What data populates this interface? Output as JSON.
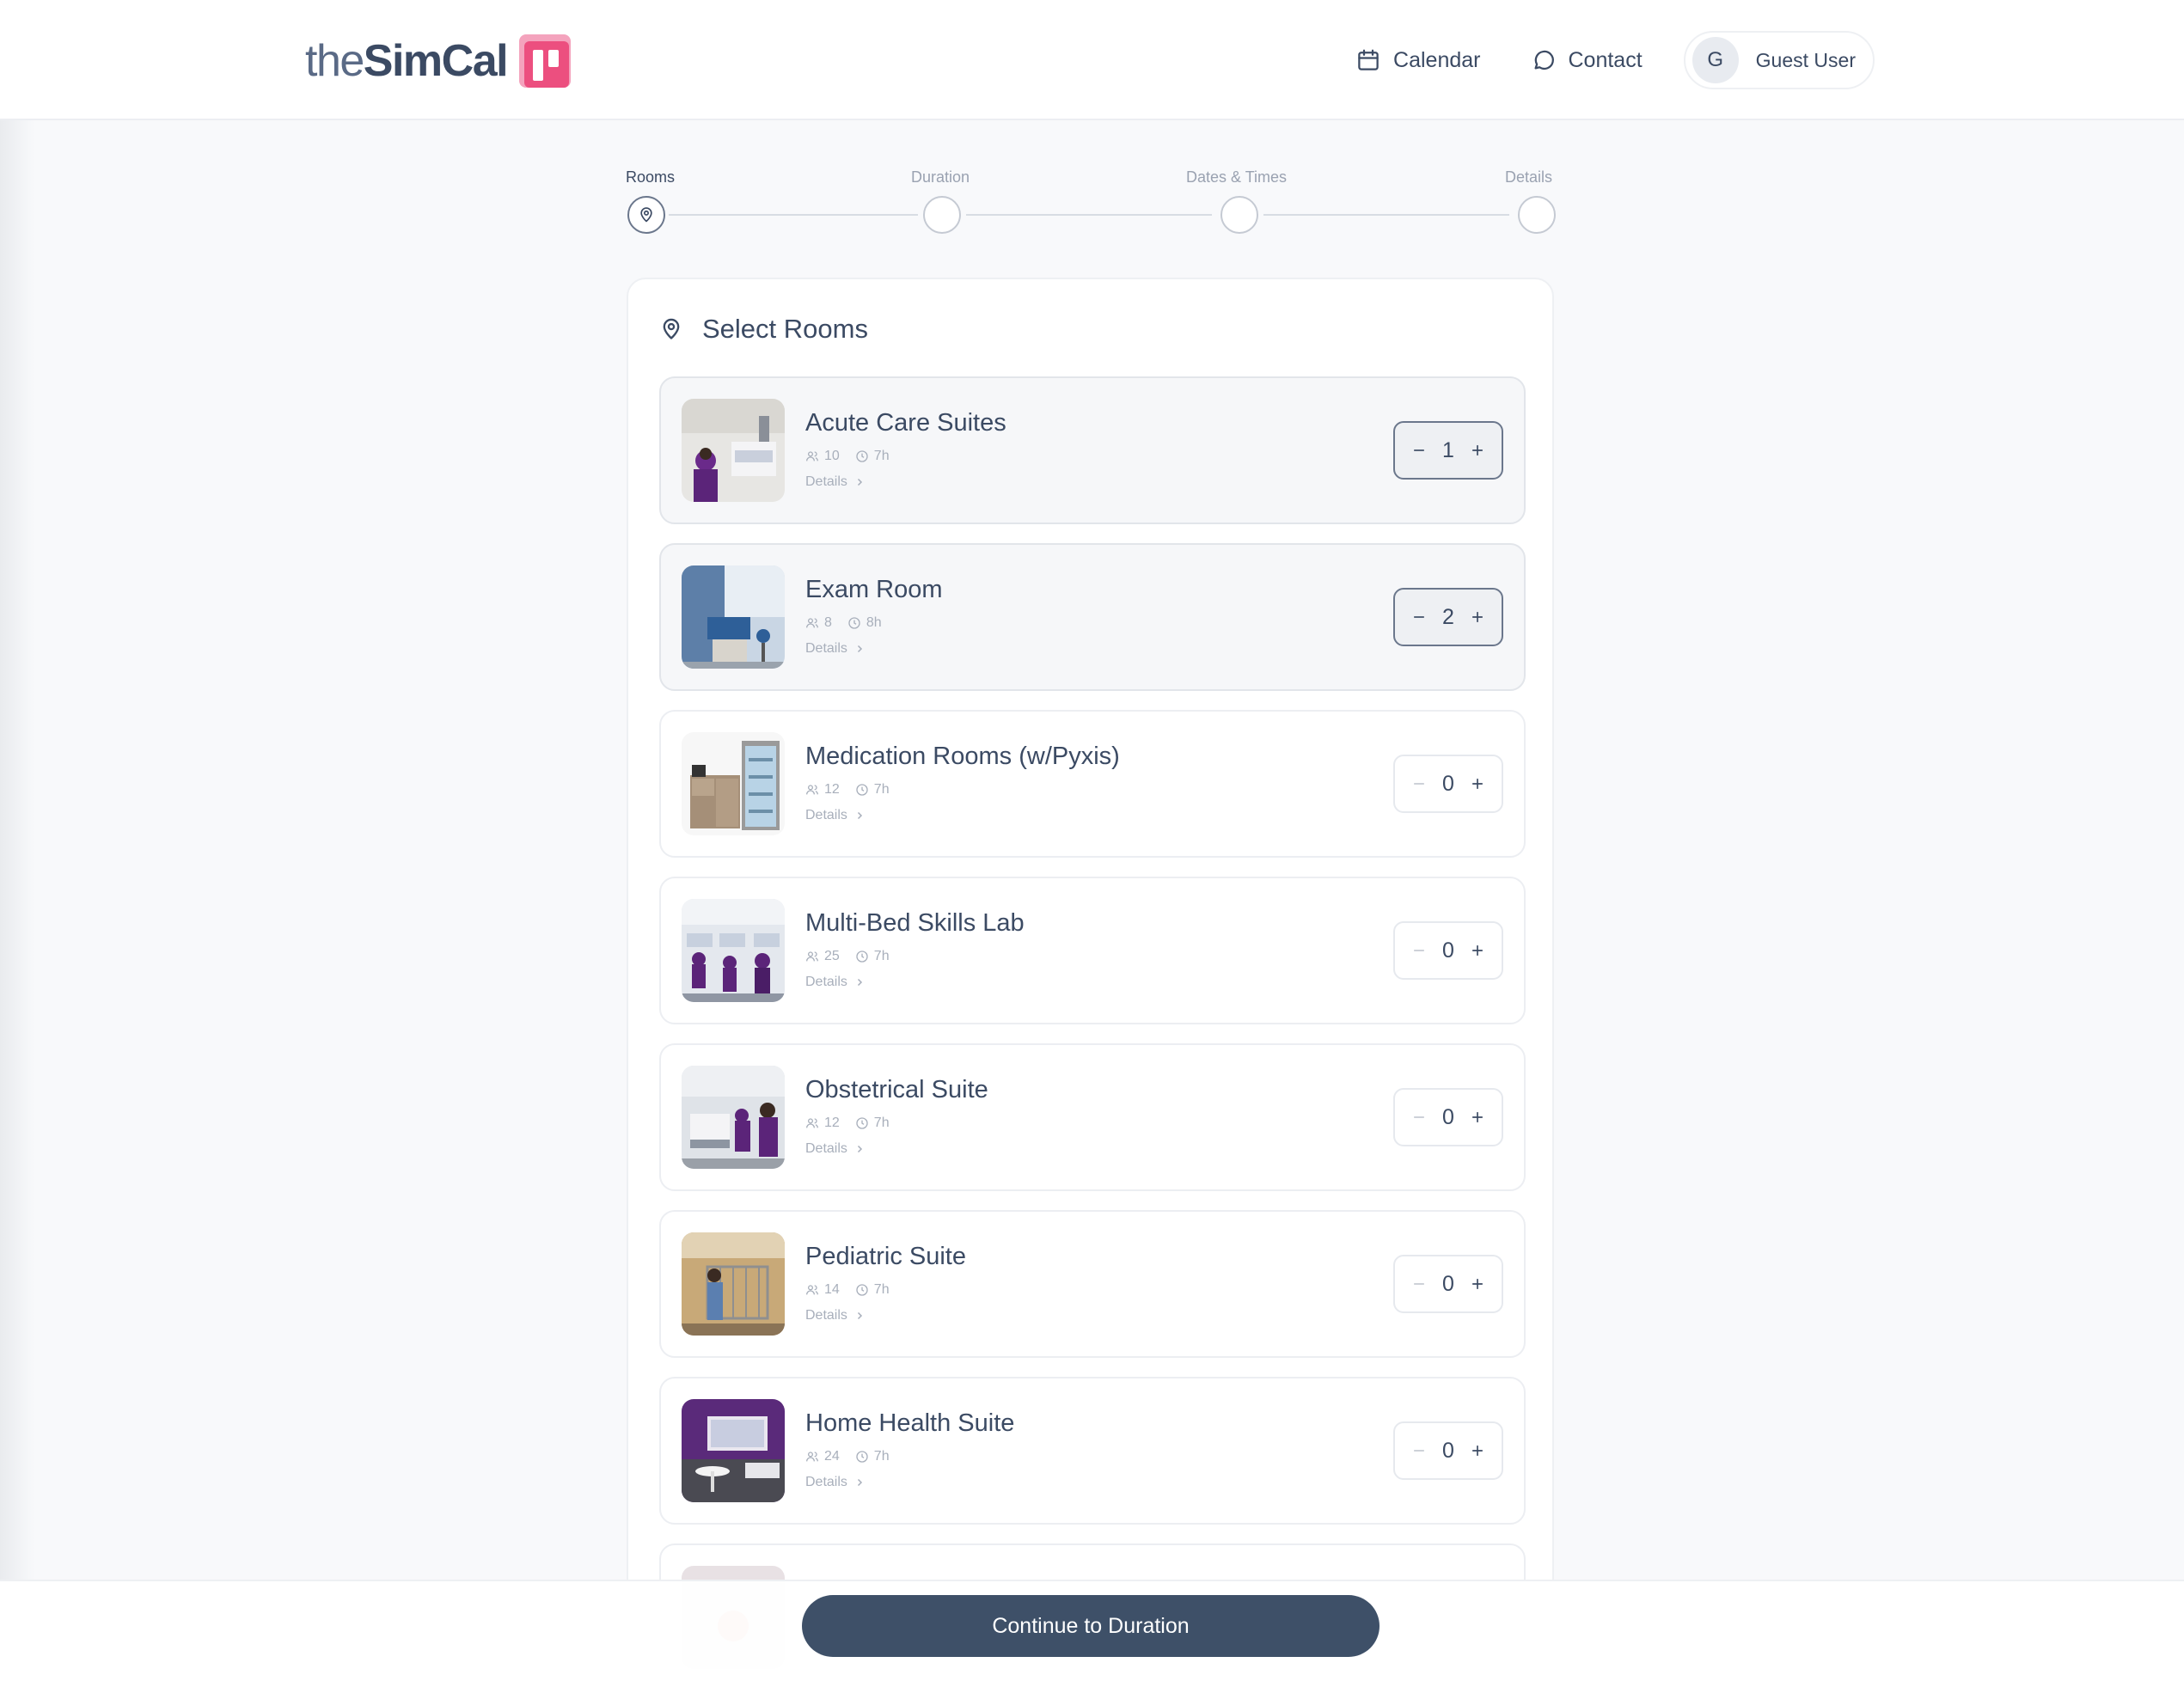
{
  "header": {
    "logo_the": "the",
    "logo_simcal": "SimCal",
    "nav": {
      "calendar_label": "Calendar",
      "contact_label": "Contact"
    },
    "user": {
      "initial": "G",
      "name": "Guest User"
    }
  },
  "stepper": {
    "steps": [
      {
        "label": "Rooms",
        "active": true
      },
      {
        "label": "Duration",
        "active": false
      },
      {
        "label": "Dates & Times",
        "active": false
      },
      {
        "label": "Details",
        "active": false
      }
    ]
  },
  "card": {
    "title": "Select Rooms"
  },
  "rooms": [
    {
      "name": "Acute Care Suites",
      "capacity": "10",
      "duration": "7h",
      "details_label": "Details",
      "quantity": "1",
      "selected": true
    },
    {
      "name": "Exam Room",
      "capacity": "8",
      "duration": "8h",
      "details_label": "Details",
      "quantity": "2",
      "selected": true
    },
    {
      "name": "Medication Rooms (w/Pyxis)",
      "capacity": "12",
      "duration": "7h",
      "details_label": "Details",
      "quantity": "0",
      "selected": false
    },
    {
      "name": "Multi-Bed Skills Lab",
      "capacity": "25",
      "duration": "7h",
      "details_label": "Details",
      "quantity": "0",
      "selected": false
    },
    {
      "name": "Obstetrical Suite",
      "capacity": "12",
      "duration": "7h",
      "details_label": "Details",
      "quantity": "0",
      "selected": false
    },
    {
      "name": "Pediatric Suite",
      "capacity": "14",
      "duration": "7h",
      "details_label": "Details",
      "quantity": "0",
      "selected": false
    },
    {
      "name": "Home Health Suite",
      "capacity": "24",
      "duration": "7h",
      "details_label": "Details",
      "quantity": "0",
      "selected": false
    }
  ],
  "footer": {
    "continue_label": "Continue to Duration"
  },
  "colors": {
    "primary": "#3e5068",
    "brand_pink": "#ec4f7f",
    "text": "#3b4a63",
    "muted": "#a8afbb"
  }
}
